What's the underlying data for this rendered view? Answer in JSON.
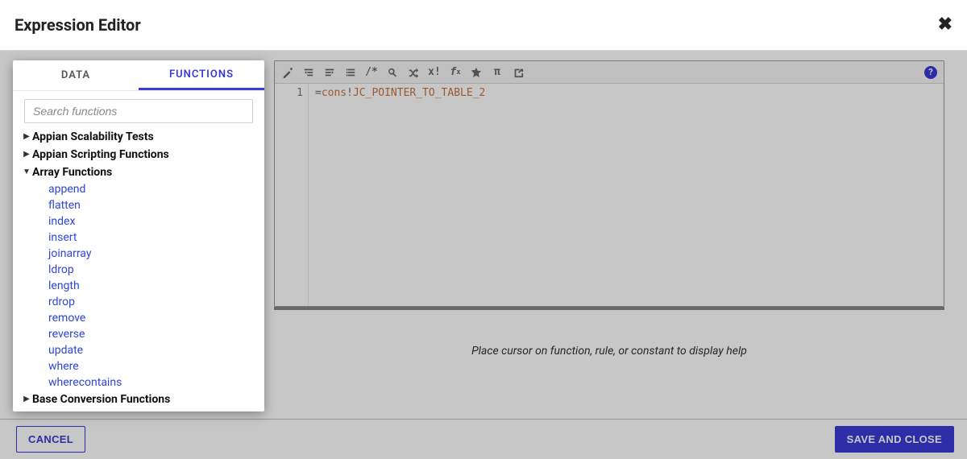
{
  "header": {
    "title": "Expression Editor"
  },
  "panel": {
    "tabs": {
      "data": "DATA",
      "functions": "FUNCTIONS",
      "active": "functions"
    },
    "search_placeholder": "Search functions",
    "categories": [
      {
        "label": "Appian Scalability Tests",
        "expanded": false,
        "children": []
      },
      {
        "label": "Appian Scripting Functions",
        "expanded": false,
        "children": []
      },
      {
        "label": "Array Functions",
        "expanded": true,
        "children": [
          "append",
          "flatten",
          "index",
          "insert",
          "joinarray",
          "ldrop",
          "length",
          "rdrop",
          "remove",
          "reverse",
          "update",
          "where",
          "wherecontains"
        ]
      },
      {
        "label": "Base Conversion Functions",
        "expanded": false,
        "children": []
      }
    ]
  },
  "toolbar_icons": [
    "magic-wand-icon",
    "outdent-icon",
    "indent-icon",
    "list-indent-icon",
    "comment-icon",
    "search-icon",
    "shuffle-icon",
    "x-bang-icon",
    "fx-icon",
    "star-icon",
    "pi-icon",
    "export-icon"
  ],
  "editor": {
    "line_number": "1",
    "operator": "=",
    "keyword": "cons",
    "separator": "!",
    "identifier": "JC_POINTER_TO_TABLE_2"
  },
  "help_hint": "Place cursor on function, rule, or constant to display help",
  "footer": {
    "cancel": "CANCEL",
    "save": "SAVE AND CLOSE"
  }
}
